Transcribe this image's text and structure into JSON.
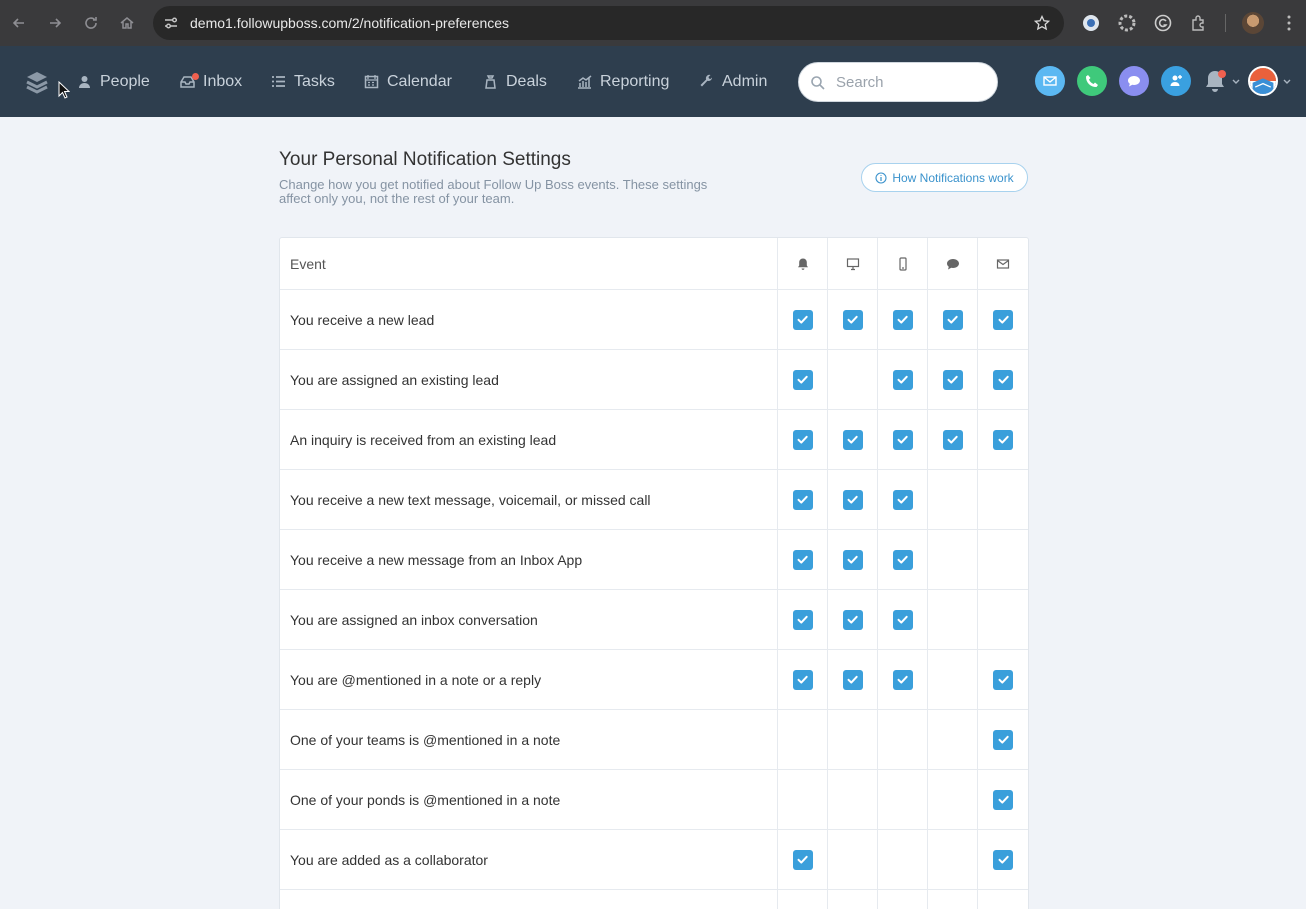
{
  "browser": {
    "url": "demo1.followupboss.com/2/notification-preferences"
  },
  "nav": {
    "items": [
      {
        "label": "People",
        "icon": "person-icon"
      },
      {
        "label": "Inbox",
        "icon": "inbox-icon"
      },
      {
        "label": "Tasks",
        "icon": "list-icon"
      },
      {
        "label": "Calendar",
        "icon": "calendar-icon"
      },
      {
        "label": "Deals",
        "icon": "deals-icon"
      },
      {
        "label": "Reporting",
        "icon": "chart-icon"
      },
      {
        "label": "Admin",
        "icon": "wrench-icon"
      }
    ],
    "search_placeholder": "Search"
  },
  "page": {
    "title": "Your Personal Notification Settings",
    "subtitle": "Change how you get notified about Follow Up Boss events. These settings affect only you, not the rest of your team.",
    "help_button": "How Notifications work"
  },
  "table": {
    "header_label": "Event",
    "channels": [
      "bell-icon",
      "desktop-icon",
      "mobile-icon",
      "chat-icon",
      "email-icon"
    ],
    "rows": [
      {
        "event": "You receive a new lead",
        "checks": [
          true,
          true,
          true,
          true,
          true
        ]
      },
      {
        "event": "You are assigned an existing lead",
        "checks": [
          true,
          false,
          true,
          true,
          true
        ]
      },
      {
        "event": "An inquiry is received from an existing lead",
        "checks": [
          true,
          true,
          true,
          true,
          true
        ]
      },
      {
        "event": "You receive a new text message, voicemail, or missed call",
        "checks": [
          true,
          true,
          true,
          false,
          false
        ]
      },
      {
        "event": "You receive a new message from an Inbox App",
        "checks": [
          true,
          true,
          true,
          false,
          false
        ]
      },
      {
        "event": "You are assigned an inbox conversation",
        "checks": [
          true,
          true,
          true,
          false,
          false
        ]
      },
      {
        "event": "You are @mentioned in a note or a reply",
        "checks": [
          true,
          true,
          true,
          false,
          true
        ]
      },
      {
        "event": "One of your teams is @mentioned in a note",
        "checks": [
          false,
          false,
          false,
          false,
          true
        ]
      },
      {
        "event": "One of your ponds is @mentioned in a note",
        "checks": [
          false,
          false,
          false,
          false,
          true
        ]
      },
      {
        "event": "You are added as a collaborator",
        "checks": [
          true,
          false,
          false,
          false,
          true
        ]
      }
    ]
  },
  "colors": {
    "accent": "#3a9fdb",
    "header_bg": "#2e3e4e",
    "page_bg": "#f0f3f8"
  }
}
